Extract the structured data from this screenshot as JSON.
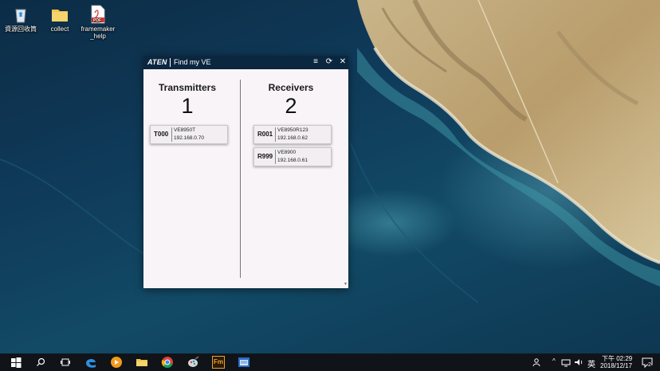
{
  "desktop": {
    "icons": [
      {
        "label": "資源回收筒",
        "icon": "recycle-bin-icon"
      },
      {
        "label": "collect",
        "icon": "folder-icon"
      },
      {
        "label": "framemaker\n_help",
        "icon": "pdf-file-icon"
      }
    ],
    "pdf_badge": "PDF"
  },
  "window": {
    "brand": "ATEN",
    "title": "Find my VE",
    "controls": {
      "sort": "≡",
      "refresh": "⟳",
      "close": "✕"
    },
    "transmitters": {
      "heading": "Transmitters",
      "count": "1",
      "devices": [
        {
          "id": "T000",
          "model": "VE8950T",
          "ip": "192.168.0.70"
        }
      ]
    },
    "receivers": {
      "heading": "Receivers",
      "count": "2",
      "devices": [
        {
          "id": "R001",
          "model": "VE8950R123",
          "ip": "192.168.0.62"
        },
        {
          "id": "R999",
          "model": "VE8900",
          "ip": "192.168.0.61"
        }
      ]
    }
  },
  "taskbar": {
    "apps": [
      "start-icon",
      "search-icon",
      "task-view-icon",
      "edge-icon",
      "media-player-icon",
      "file-explorer-icon",
      "chrome-icon",
      "paint-icon",
      "framemaker-icon",
      "app-window-icon"
    ],
    "framemaker_label": "Fm",
    "tray": {
      "input_method": "英",
      "time": "下午 02:29",
      "date": "2018/12/17",
      "notification_count": "2"
    }
  },
  "colors": {
    "title_bar": "#0b2740",
    "window_bg": "#f8f4f8",
    "taskbar": "#101418"
  }
}
